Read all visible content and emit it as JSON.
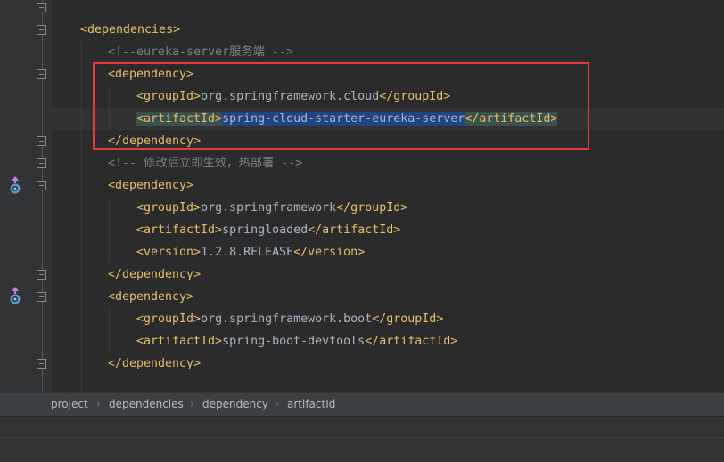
{
  "code": {
    "l1_tag": "<dependencies>",
    "l2_comment": "<!--eureka-server服务端 -->",
    "l3_tag": "<dependency>",
    "l4_open": "<groupId>",
    "l4_value": "org.springframework.cloud",
    "l4_close": "</groupId>",
    "l5_open": "<artifactId>",
    "l5_value": "spring-cloud-starter-eureka-server",
    "l5_close": "</artifactId>",
    "l6_tag": "</dependency>",
    "l7_comment": "<!-- 修改后立即生效，热部署 -->",
    "l8_tag": "<dependency>",
    "l9_open": "<groupId>",
    "l9_value": "org.springframework",
    "l9_close": "</groupId>",
    "l10_open": "<artifactId>",
    "l10_value": "springloaded",
    "l10_close": "</artifactId>",
    "l11_open": "<version>",
    "l11_value": "1.2.8.RELEASE",
    "l11_close": "</version>",
    "l12_tag": "</dependency>",
    "l13_tag": "<dependency>",
    "l14_open": "<groupId>",
    "l14_value": "org.springframework.boot",
    "l14_close": "</groupId>",
    "l15_open": "<artifactId>",
    "l15_value": "spring-boot-devtools",
    "l15_close": "</artifactId>",
    "l16_tag": "</dependency>"
  },
  "breadcrumb": [
    "project",
    "dependencies",
    "dependency",
    "artifactId"
  ],
  "breadcrumb_separator": "›",
  "icons": {
    "gutter_marker": "override-method-icon",
    "fold": "fold-toggle-icon"
  },
  "colors": {
    "background": "#2b2b2b",
    "tag": "#e8bf6a",
    "text": "#a9b7c6",
    "comment": "#808080",
    "selection": "#214283",
    "highlight_box": "#e5393a"
  }
}
